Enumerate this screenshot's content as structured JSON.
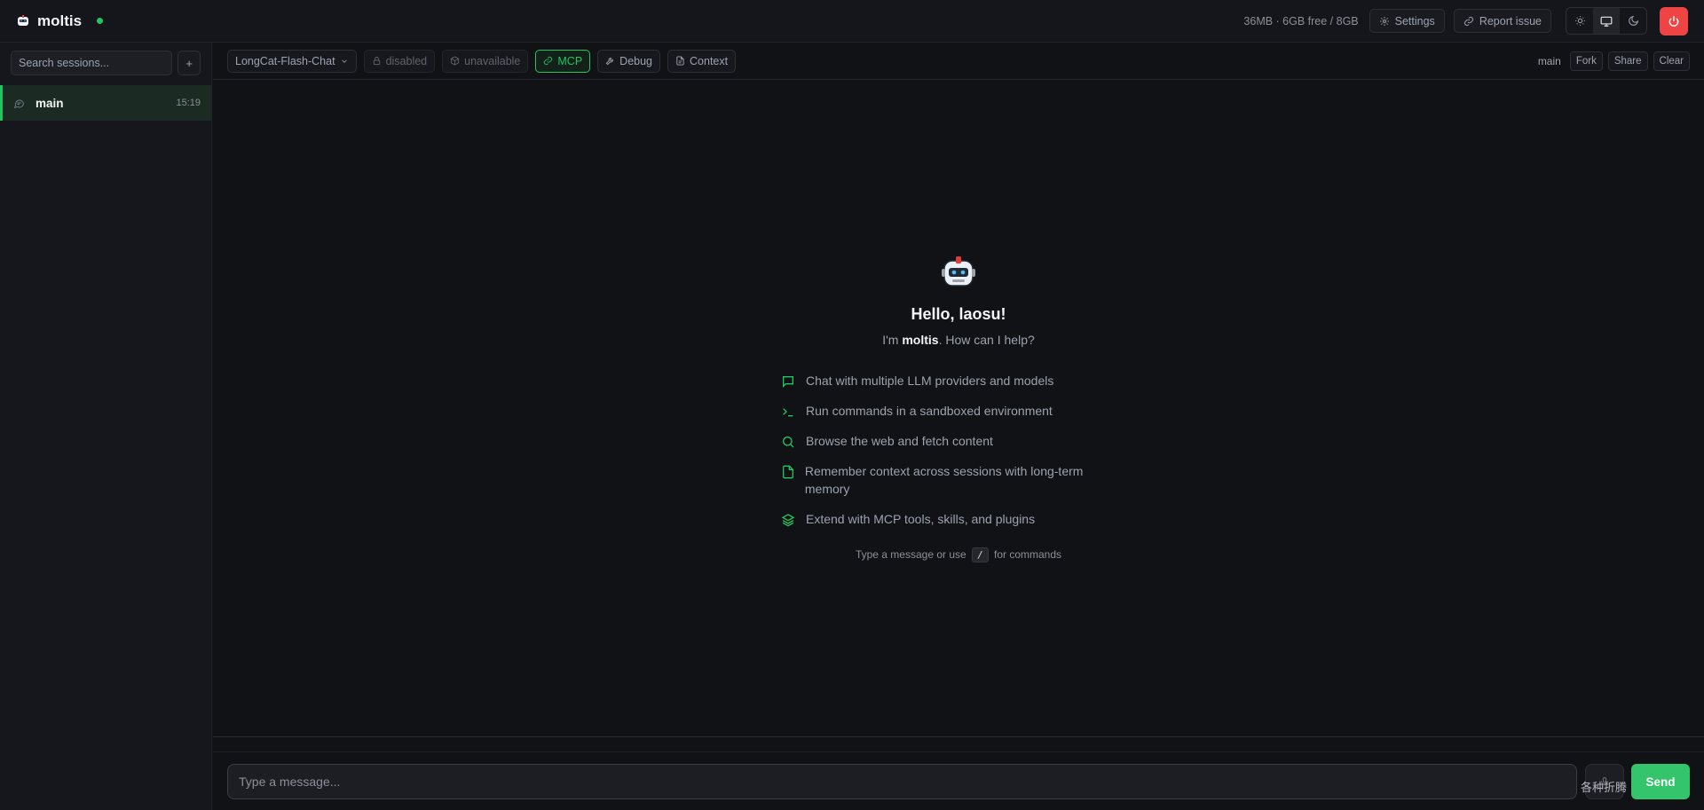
{
  "header": {
    "app_name": "moltis",
    "memory": "36MB · 6GB free / 8GB",
    "settings_label": "Settings",
    "report_label": "Report issue"
  },
  "sidebar": {
    "search_placeholder": "Search sessions...",
    "new_session_label": "+",
    "sessions": [
      {
        "name": "main",
        "time": "15:19"
      }
    ]
  },
  "toolbar": {
    "model": "LongCat-Flash-Chat",
    "lock_chip": "disabled",
    "sandbox_chip": "unavailable",
    "mcp_chip": "MCP",
    "debug_chip": "Debug",
    "context_chip": "Context",
    "branch": "main",
    "fork_label": "Fork",
    "share_label": "Share",
    "clear_label": "Clear"
  },
  "welcome": {
    "greeting": "Hello, laosu!",
    "intro_prefix": "I'm ",
    "intro_name": "moltis",
    "intro_suffix": ". How can I help?",
    "features": [
      "Chat with multiple LLM providers and models",
      "Run commands in a sandboxed environment",
      "Browse the web and fetch content",
      "Remember context across sessions with long-term memory",
      "Extend with MCP tools, skills, and plugins"
    ],
    "hint_prefix": "Type a message or use",
    "hint_key": "/",
    "hint_suffix": "for commands"
  },
  "composer": {
    "placeholder": "Type a message...",
    "send_label": "Send"
  },
  "watermark": "各种折腾",
  "colors": {
    "accent": "#22c55e",
    "power": "#ef4444",
    "send": "#34c46c",
    "background": "#111216"
  },
  "icons": {
    "brand": "robot-logo-icon",
    "settings": "gear-icon",
    "report": "link-icon",
    "theme_light": "sun-icon",
    "theme_system": "monitor-icon",
    "theme_dark": "moon-icon",
    "power": "power-icon",
    "features": [
      "chat-bubble-icon",
      "terminal-icon",
      "search-icon",
      "document-icon",
      "layers-icon"
    ]
  }
}
